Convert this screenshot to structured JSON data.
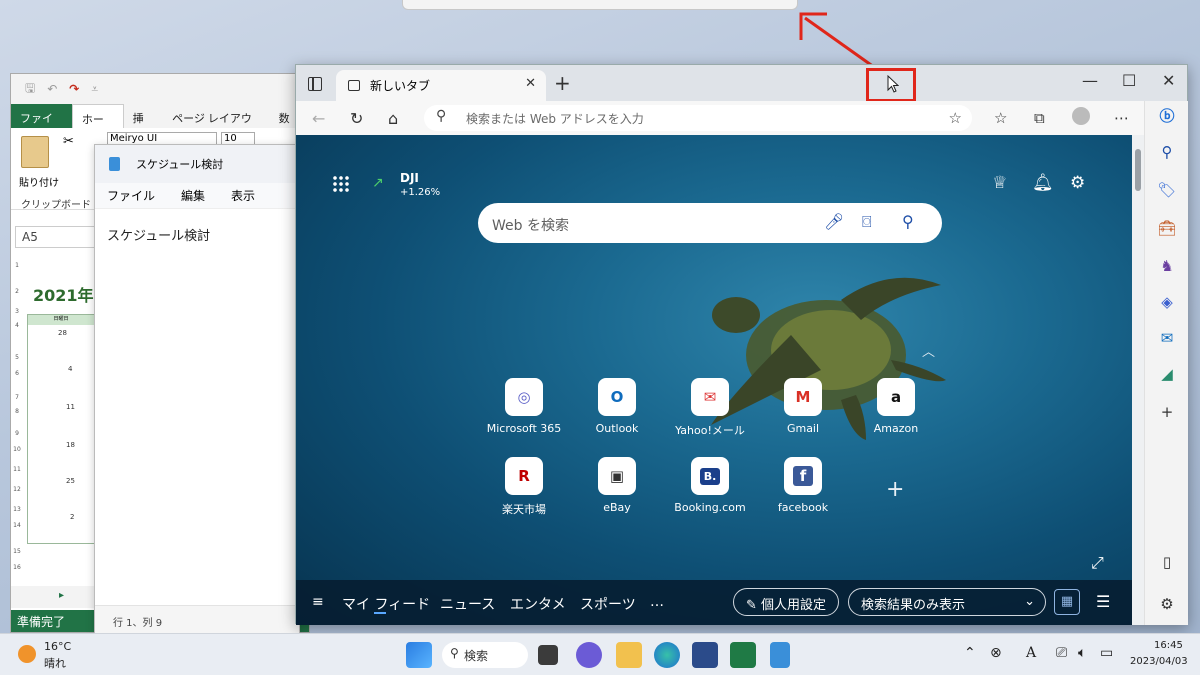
{
  "excel": {
    "tabs": [
      "ファイル",
      "ホーム",
      "挿入",
      "ページ レイアウト",
      "数式"
    ],
    "paste_label": "貼り付け",
    "clipboard_label": "クリップボード",
    "font_name": "Meiryo UI",
    "font_size": "10",
    "name_box": "A5",
    "sheet_title": "2021年",
    "cal_header": "日曜日",
    "cal_numbers": [
      "28",
      "4",
      "11",
      "18",
      "25",
      "2"
    ],
    "row_numbers": [
      "1",
      "2",
      "3",
      "4",
      "5",
      "6",
      "7",
      "8",
      "9",
      "10",
      "11",
      "12",
      "13",
      "14",
      "15",
      "16"
    ],
    "status": "準備完了"
  },
  "notepad": {
    "title": "スケジュール検討",
    "menu": [
      "ファイル",
      "編集",
      "表示"
    ],
    "content": "スケジュール検討",
    "status": "行 1、列 9"
  },
  "edge": {
    "tab_title": "新しいタブ",
    "address_placeholder": "検索または Web アドレスを入力",
    "ticker": {
      "name": "DJI",
      "change": "+1.26%"
    },
    "web_search_placeholder": "Web を検索",
    "tiles": [
      {
        "label": "Microsoft 365",
        "glyph": "◎",
        "color": "#5b5fc7"
      },
      {
        "label": "Outlook",
        "glyph": "O",
        "color": "#0f6cbd"
      },
      {
        "label": "Yahoo!メール",
        "glyph": "✉",
        "color": "#d33"
      },
      {
        "label": "Gmail",
        "glyph": "M",
        "color": "#d93025"
      },
      {
        "label": "Amazon",
        "glyph": "a",
        "color": "#111"
      },
      {
        "label": "楽天市場",
        "glyph": "R",
        "color": "#bf0000"
      },
      {
        "label": "eBay",
        "glyph": "▣",
        "color": "#333"
      },
      {
        "label": "Booking.com",
        "glyph": "B.",
        "color": "#fff"
      },
      {
        "label": "facebook",
        "glyph": "f",
        "color": "#fff"
      }
    ],
    "feed": [
      "マイ フィード",
      "ニュース",
      "エンタメ",
      "スポーツ",
      "…"
    ],
    "personalize": "個人用設定",
    "content_visibility": "検索結果のみ表示"
  },
  "taskbar": {
    "temperature": "16°C",
    "condition": "晴れ",
    "search": "検索",
    "time": "16:45",
    "date": "2023/04/03"
  }
}
